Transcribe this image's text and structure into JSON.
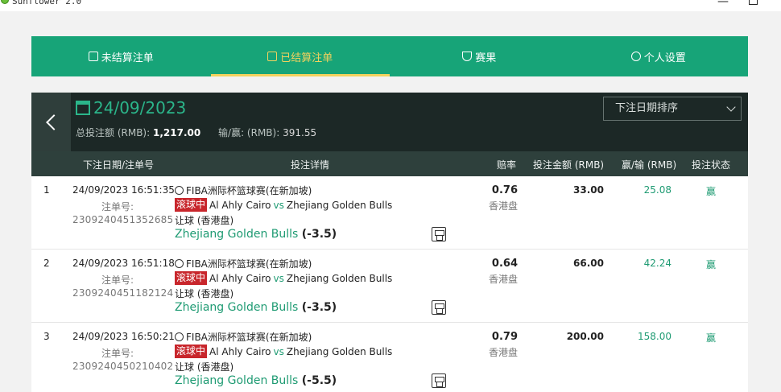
{
  "window": {
    "title": "Sunflower 2.0",
    "min_glyph": "—"
  },
  "nav": {
    "tabs": [
      {
        "label": "未结算注单",
        "icon": "ticket-icon"
      },
      {
        "label": "已结算注单",
        "icon": "clipboard-icon"
      },
      {
        "label": "赛果",
        "icon": "trophy-icon"
      },
      {
        "label": "个人设置",
        "icon": "gear-icon"
      }
    ],
    "active_tab": 1
  },
  "header": {
    "date": "24/09/2023",
    "total_stake_label": "总投注额 (RMB):",
    "total_stake_value": "1,217.00",
    "win_loss_label": "输/赢: (RMB):",
    "win_loss_value": "391.55",
    "sort_select": "下注日期排序"
  },
  "columns": {
    "date_ticket": "下注日期/注单号",
    "details": "投注详情",
    "odds": "赔率",
    "stake": "投注金额 (RMB)",
    "win_loss": "赢/输 (RMB)",
    "status": "投注状态"
  },
  "rows": [
    {
      "index": "1",
      "datetime": "24/09/2023 16:51:35",
      "ticket_label": "注单号:",
      "ticket_no": "2309240451352685",
      "league": "FIBA洲际杯篮球赛(在新加坡)",
      "live_badge": "滚球中",
      "home": "Al Ahly Cairo",
      "vs": "vs",
      "away": "Zhejiang Golden Bulls",
      "market": "让球 (香港盘)",
      "pick_team": "Zhejiang Golden Bulls",
      "pick_line": "(-3.5)",
      "odds": "0.76",
      "odds_type": "香港盘",
      "stake": "33.00",
      "win_loss": "25.08",
      "status": "赢"
    },
    {
      "index": "2",
      "datetime": "24/09/2023 16:51:18",
      "ticket_label": "注单号:",
      "ticket_no": "2309240451182124",
      "league": "FIBA洲际杯篮球赛(在新加坡)",
      "live_badge": "滚球中",
      "home": "Al Ahly Cairo",
      "vs": "vs",
      "away": "Zhejiang Golden Bulls",
      "market": "让球 (香港盘)",
      "pick_team": "Zhejiang Golden Bulls",
      "pick_line": "(-3.5)",
      "odds": "0.64",
      "odds_type": "香港盘",
      "stake": "66.00",
      "win_loss": "42.24",
      "status": "赢"
    },
    {
      "index": "3",
      "datetime": "24/09/2023 16:50:21",
      "ticket_label": "注单号:",
      "ticket_no": "2309240450210402",
      "league": "FIBA洲际杯篮球赛(在新加坡)",
      "live_badge": "滚球中",
      "home": "Al Ahly Cairo",
      "vs": "vs",
      "away": "Zhejiang Golden Bulls",
      "market": "让球 (香港盘)",
      "pick_team": "Zhejiang Golden Bulls",
      "pick_line": "(-5.5)",
      "odds": "0.79",
      "odds_type": "香港盘",
      "stake": "200.00",
      "win_loss": "158.00",
      "status": "赢"
    }
  ]
}
